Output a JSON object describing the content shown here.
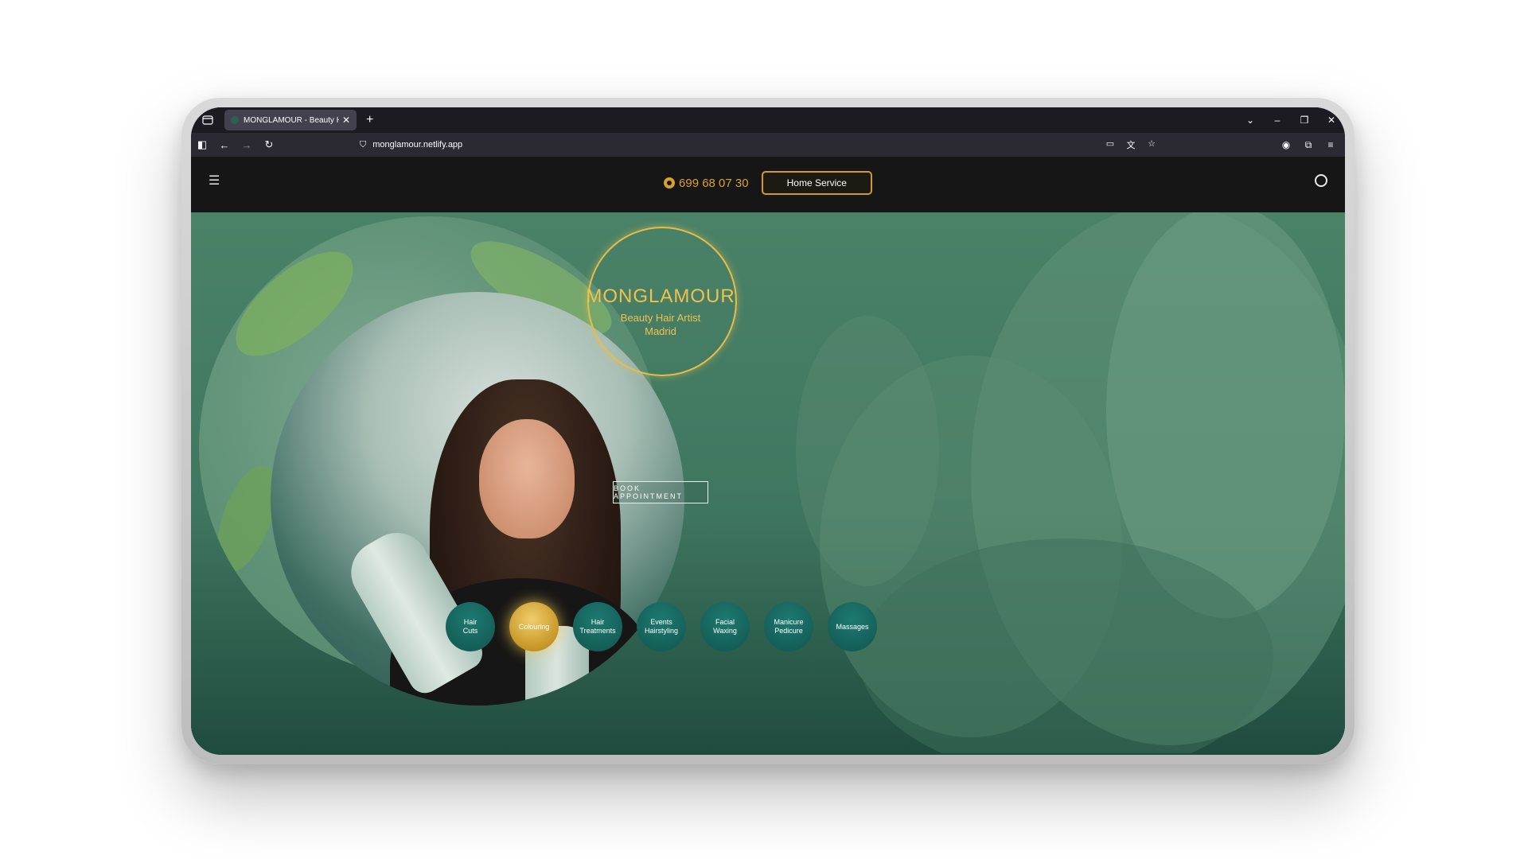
{
  "browser": {
    "tab_title": "MONGLAMOUR - Beauty Hair A",
    "tab_close": "✕",
    "new_tab": "+",
    "url": "monglamour.netlify.app"
  },
  "header": {
    "phone": "699 68 07 30",
    "home_service": "Home Service"
  },
  "hero": {
    "logo_title": "MONGLAMOUR",
    "logo_line1": "Beauty Hair Artist",
    "logo_line2": "Madrid",
    "book_button": "BOOK APPOINTMENT"
  },
  "services": [
    {
      "line1": "Hair",
      "line2": "Cuts"
    },
    {
      "line1": "Colouring",
      "line2": ""
    },
    {
      "line1": "Hair",
      "line2": "Treatments"
    },
    {
      "line1": "Events",
      "line2": "Hairstyling"
    },
    {
      "line1": "Facial",
      "line2": "Waxing"
    },
    {
      "line1": "Manicure",
      "line2": "Pedicure"
    },
    {
      "line1": "Massages",
      "line2": ""
    }
  ],
  "colors": {
    "gold": "#d7a22b",
    "hero_green": "#4a8268",
    "service_teal": "#11554f"
  }
}
